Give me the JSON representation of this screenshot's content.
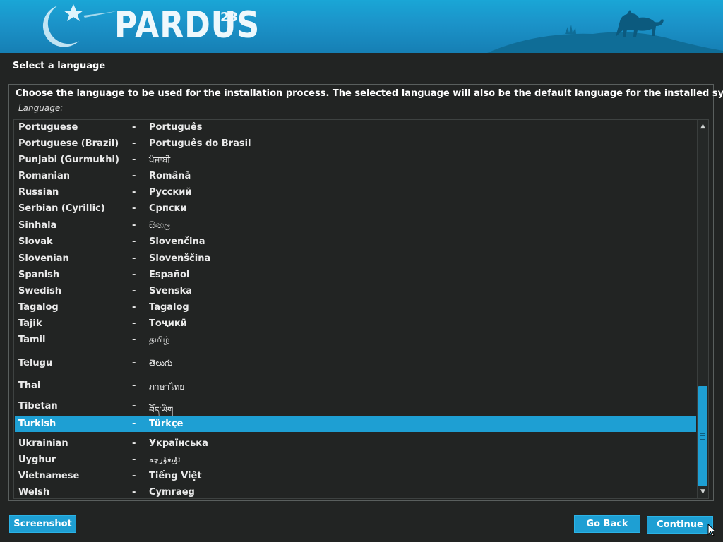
{
  "banner": {
    "brand": "PARDUS",
    "version": "23"
  },
  "header": {
    "title": "Select a language"
  },
  "instruction": "Choose the language to be used for the installation process. The selected language will also be the default language for the installed system.",
  "list_label": "Language:",
  "languages": [
    {
      "en": "Portuguese",
      "native": "Português"
    },
    {
      "en": "Portuguese (Brazil)",
      "native": "Português do Brasil"
    },
    {
      "en": "Punjabi (Gurmukhi)",
      "native": "ਪੰਜਾਬੀ"
    },
    {
      "en": "Romanian",
      "native": "Română"
    },
    {
      "en": "Russian",
      "native": "Русский"
    },
    {
      "en": "Serbian (Cyrillic)",
      "native": "Српски"
    },
    {
      "en": "Sinhala",
      "native": "සිංහල"
    },
    {
      "en": "Slovak",
      "native": "Slovenčina"
    },
    {
      "en": "Slovenian",
      "native": "Slovenščina"
    },
    {
      "en": "Spanish",
      "native": "Español"
    },
    {
      "en": "Swedish",
      "native": "Svenska"
    },
    {
      "en": "Tagalog",
      "native": "Tagalog"
    },
    {
      "en": "Tajik",
      "native": "Тоҷикӣ"
    },
    {
      "en": "Tamil",
      "native": "தமிழ்"
    },
    {
      "en": "Telugu",
      "native": "తెలుగు"
    },
    {
      "en": "Thai",
      "native": "ภาษาไทย"
    },
    {
      "en": "Tibetan",
      "native": "བོད་ཡིག"
    },
    {
      "en": "Turkish",
      "native": "Türkçe",
      "selected": true
    },
    {
      "en": "Ukrainian",
      "native": "Українська"
    },
    {
      "en": "Uyghur",
      "native": "ئۇيغۇرچە"
    },
    {
      "en": "Vietnamese",
      "native": "Tiếng Việt"
    },
    {
      "en": "Welsh",
      "native": "Cymraeg"
    }
  ],
  "separator": "-",
  "buttons": {
    "screenshot": "Screenshot",
    "back": "Go Back",
    "continue": "Continue"
  },
  "colors": {
    "accent": "#1e9fd3",
    "background": "#222423",
    "banner": "#1b93c9"
  }
}
